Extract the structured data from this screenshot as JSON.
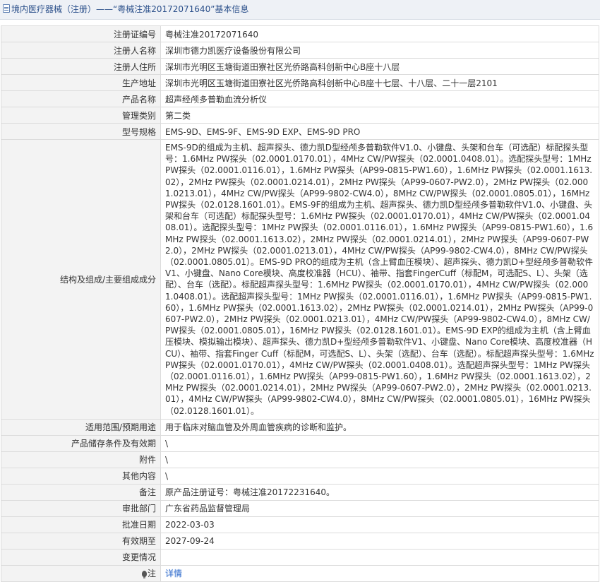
{
  "header": {
    "title": "境内医疗器械（注册）——“粤械注准20172071640”基本信息"
  },
  "rows": [
    {
      "label": "注册证编号",
      "value": "粤械注准20172071640"
    },
    {
      "label": "注册人名称",
      "value": "深圳市德力凯医疗设备股份有限公司"
    },
    {
      "label": "注册人住所",
      "value": "深圳市光明区玉塘街道田寮社区光侨路高科创新中心B座十八层"
    },
    {
      "label": "生产地址",
      "value": "深圳市光明区玉塘街道田寮社区光侨路高科创新中心B座十七层、十八层、二十一层2101"
    },
    {
      "label": "产品名称",
      "value": "超声经颅多普勒血流分析仪"
    },
    {
      "label": "管理类别",
      "value": "第二类"
    },
    {
      "label": "型号规格",
      "value": "EMS-9D、EMS-9F、EMS-9D EXP、EMS-9D PRO"
    },
    {
      "label": "结构及组成/主要组成成分",
      "value": "EMS-9D的组成为主机、超声探头、德力凯D型经颅多普勒软件V1.0、小键盘、头架和台车（可选配）标配探头型号：1.6MHz PW探头（02.0001.0170.01），4MHz CW/PW探头（02.0001.0408.01）。选配探头型号：1MHz PW探头（02.0001.0116.01），1.6MHz PW探头（AP99-0815-PW1.60），1.6MHz PW探头（02.0001.1613.02），2MHz PW探头（02.0001.0214.01），2MHz PW探头（AP99-0607-PW2.0），2MHz PW探头（02.0001.0213.01），4MHz CW/PW探头（AP99-9802-CW4.0），8MHz CW/PW探头（02.0001.0805.01），16MHz PW探头（02.0128.1601.01）。EMS-9F的组成为主机、超声探头、德力凯D型经颅多普勒软件V1.0、小键盘、头架和台车（可选配）标配探头型号：1.6MHz PW探头（02.0001.0170.01），4MHz CW/PW探头（02.0001.0408.01）。选配探头型号：1MHz PW探头（02.0001.0116.01），1.6MHz PW探头（AP99-0815-PW1.60），1.6MHz PW探头（02.0001.1613.02），2MHz PW探头（02.0001.0214.01），2MHz PW探头（AP99-0607-PW2.0），2MHz PW探头（02.0001.0213.01），4MHz CW/PW探头（AP99-9802-CW4.0），8MHz CW/PW探头（02.0001.0805.01）。EMS-9D PRO的组成为主机（含上臂血压模块）、超声探头、德力凯D+型经颅多普勒软件V1、小键盘、Nano Core模块、高度校准器（HCU）、袖带、指套FingerCuff（标配M，可选配S、L）、头架（选配）、台车（选配）。标配超声探头型号：1.6MHz PW探头（02.0001.0170.01），4MHz CW/PW探头（02.0001.0408.01）。选配超声探头型号：1MHz PW探头（02.0001.0116.01），1.6MHz PW探头（AP99-0815-PW1.60），1.6MHz PW探头（02.0001.1613.02），2MHz PW探头（02.0001.0214.01），2MHz PW探头（AP99-0607-PW2.0），2MHz PW探头（02.0001.0213.01），4MHz CW/PW探头（AP99-9802-CW4.0），8MHz CW/PW探头（02.0001.0805.01），16MHz PW探头（02.0128.1601.01）。EMS-9D EXP的组成为主机（含上臂血压模块、模拟输出模块）、超声探头、德力凯D+型经颅多普勒软件V1、小键盘、Nano Core模块、高度校准器（HCU）、袖带、指套Finger Cuff（标配M，可选配S、L）、头架（选配）、台车（选配）。标配超声探头型号：1.6MHz PW探头（02.0001.0170.01），4MHz CW/PW探头（02.0001.0408.01）。选配超声探头型号：1MHz PW探头（02.0001.0116.01），1.6MHz PW探头（AP99-0815-PW1.60），1.6MHz PW探头（02.0001.1613.02），2MHz PW探头（02.0001.0214.01），2MHz PW探头（AP99-0607-PW2.0），2MHz PW探头（02.0001.0213.01），4MHz CW/PW探头（AP99-9802-CW4.0），8MHz CW/PW探头（02.0001.0805.01），16MHz PW探头（02.0128.1601.01）。"
    },
    {
      "label": "适用范围/预期用途",
      "value": "用于临床对脑血管及外周血管疾病的诊断和监护。"
    },
    {
      "label": "产品储存条件及有效期",
      "value": "\\"
    },
    {
      "label": "附件",
      "value": "\\"
    },
    {
      "label": "其他内容",
      "value": "\\"
    },
    {
      "label": "备注",
      "value": "原产品注册证号：粤械注准20172231640。"
    },
    {
      "label": "审批部门",
      "value": "广东省药品监督管理局"
    },
    {
      "label": "批准日期",
      "value": "2022-03-03"
    },
    {
      "label": "有效期至",
      "value": "2027-09-24"
    },
    {
      "label": "变更情况",
      "value": ""
    },
    {
      "label": "注",
      "value": "详情"
    }
  ]
}
